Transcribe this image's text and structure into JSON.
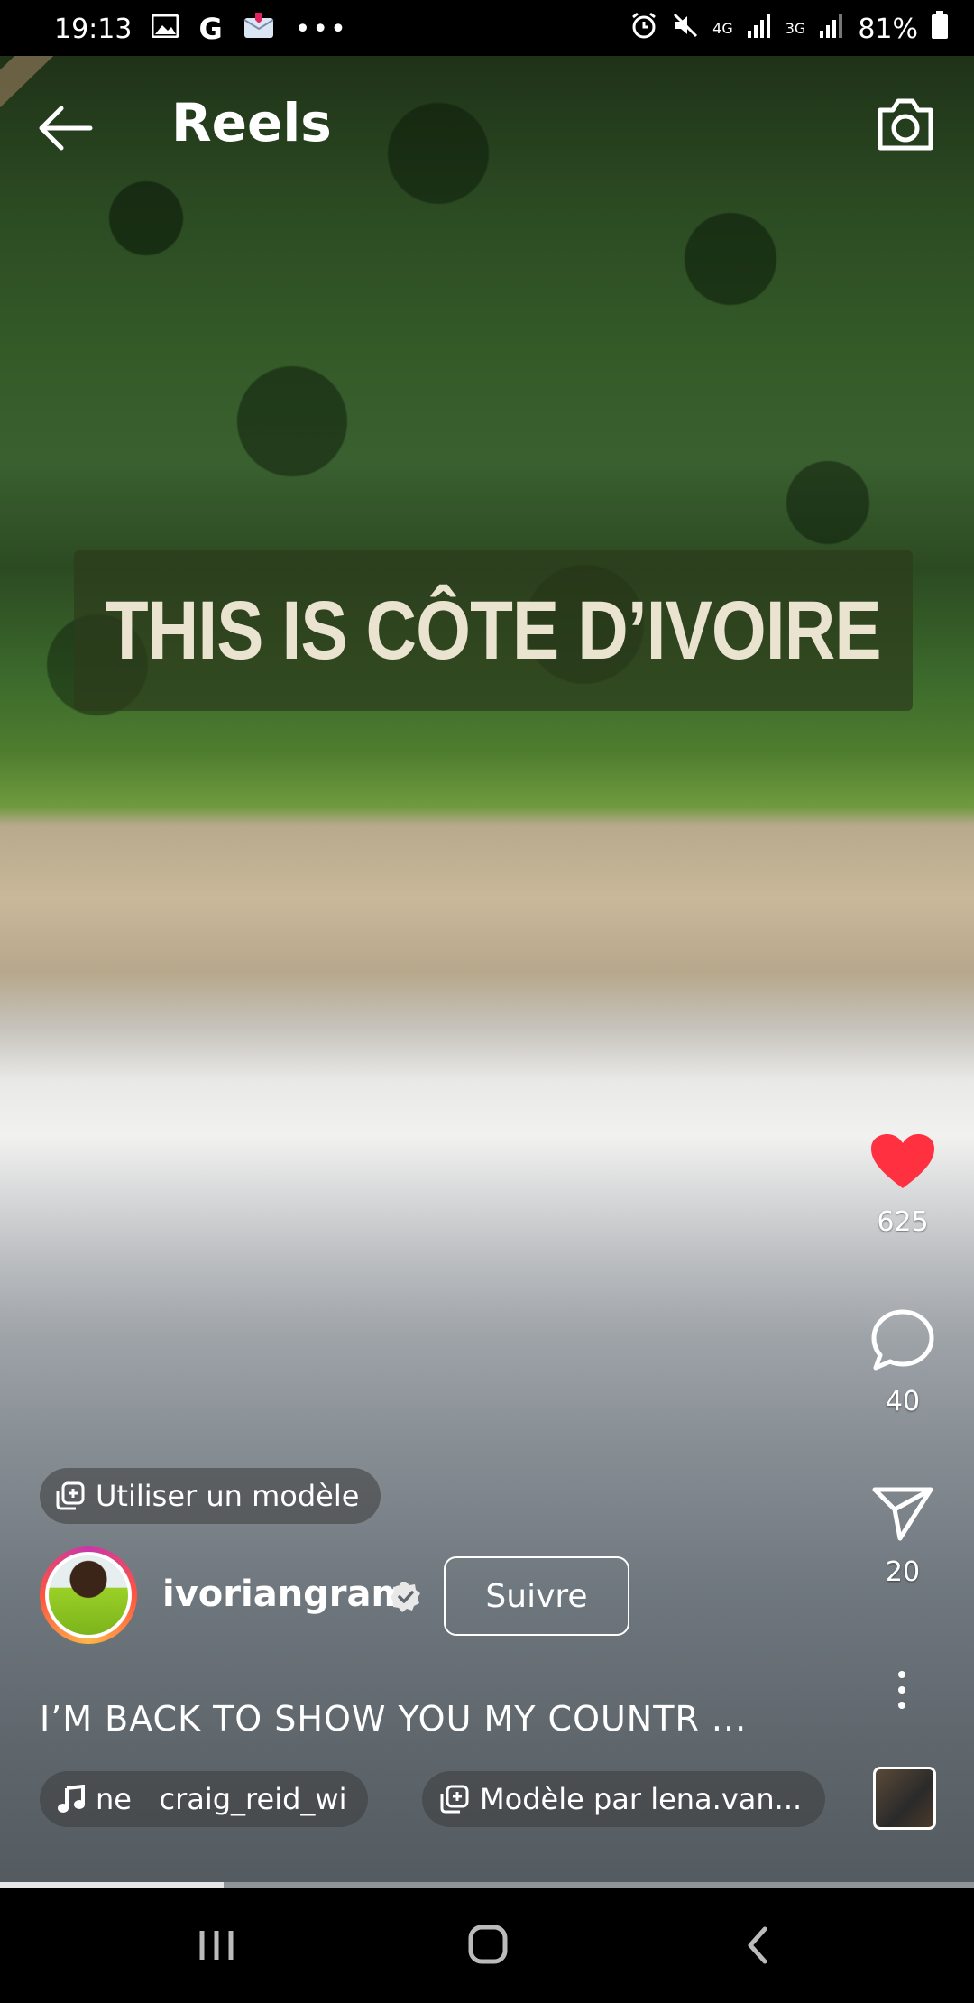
{
  "status_bar": {
    "time": "19:13",
    "network_4g": "4G",
    "network_3g": "3G",
    "battery": "81%"
  },
  "app_bar": {
    "title": "Reels"
  },
  "video": {
    "overlay_text": "THIS IS CÔTE D’IVOIRE"
  },
  "actions": {
    "likes": "625",
    "comments": "40",
    "shares": "20",
    "liked": true,
    "like_color": "#ff3040"
  },
  "post": {
    "template_label": "Utiliser un modèle",
    "username": "ivoriangram",
    "follow_label": "Suivre",
    "caption": "I’M BACK TO SHOW YOU MY COUNTR ...",
    "audio": "ne   craig_reid_wi",
    "template_by": "Modèle par lena.van..."
  },
  "progress": 0.23
}
